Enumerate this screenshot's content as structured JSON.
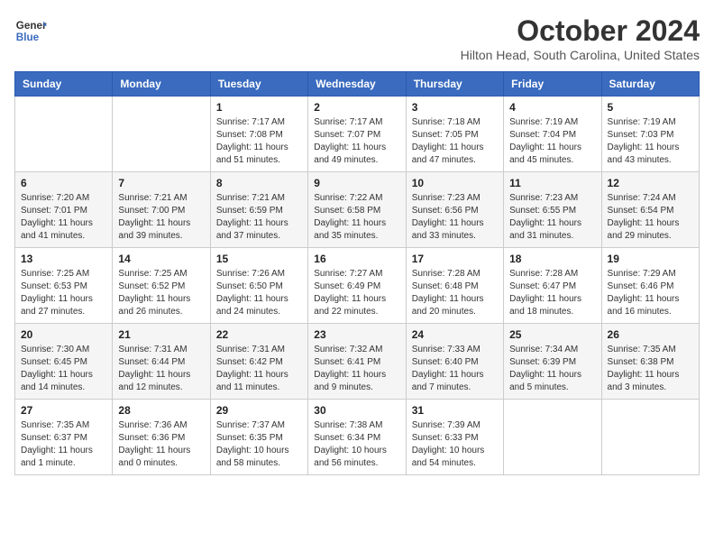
{
  "header": {
    "logo_line1": "General",
    "logo_line2": "Blue",
    "month": "October 2024",
    "location": "Hilton Head, South Carolina, United States"
  },
  "weekdays": [
    "Sunday",
    "Monday",
    "Tuesday",
    "Wednesday",
    "Thursday",
    "Friday",
    "Saturday"
  ],
  "weeks": [
    [
      {
        "day": "",
        "sunrise": "",
        "sunset": "",
        "daylight": ""
      },
      {
        "day": "",
        "sunrise": "",
        "sunset": "",
        "daylight": ""
      },
      {
        "day": "1",
        "sunrise": "Sunrise: 7:17 AM",
        "sunset": "Sunset: 7:08 PM",
        "daylight": "Daylight: 11 hours and 51 minutes."
      },
      {
        "day": "2",
        "sunrise": "Sunrise: 7:17 AM",
        "sunset": "Sunset: 7:07 PM",
        "daylight": "Daylight: 11 hours and 49 minutes."
      },
      {
        "day": "3",
        "sunrise": "Sunrise: 7:18 AM",
        "sunset": "Sunset: 7:05 PM",
        "daylight": "Daylight: 11 hours and 47 minutes."
      },
      {
        "day": "4",
        "sunrise": "Sunrise: 7:19 AM",
        "sunset": "Sunset: 7:04 PM",
        "daylight": "Daylight: 11 hours and 45 minutes."
      },
      {
        "day": "5",
        "sunrise": "Sunrise: 7:19 AM",
        "sunset": "Sunset: 7:03 PM",
        "daylight": "Daylight: 11 hours and 43 minutes."
      }
    ],
    [
      {
        "day": "6",
        "sunrise": "Sunrise: 7:20 AM",
        "sunset": "Sunset: 7:01 PM",
        "daylight": "Daylight: 11 hours and 41 minutes."
      },
      {
        "day": "7",
        "sunrise": "Sunrise: 7:21 AM",
        "sunset": "Sunset: 7:00 PM",
        "daylight": "Daylight: 11 hours and 39 minutes."
      },
      {
        "day": "8",
        "sunrise": "Sunrise: 7:21 AM",
        "sunset": "Sunset: 6:59 PM",
        "daylight": "Daylight: 11 hours and 37 minutes."
      },
      {
        "day": "9",
        "sunrise": "Sunrise: 7:22 AM",
        "sunset": "Sunset: 6:58 PM",
        "daylight": "Daylight: 11 hours and 35 minutes."
      },
      {
        "day": "10",
        "sunrise": "Sunrise: 7:23 AM",
        "sunset": "Sunset: 6:56 PM",
        "daylight": "Daylight: 11 hours and 33 minutes."
      },
      {
        "day": "11",
        "sunrise": "Sunrise: 7:23 AM",
        "sunset": "Sunset: 6:55 PM",
        "daylight": "Daylight: 11 hours and 31 minutes."
      },
      {
        "day": "12",
        "sunrise": "Sunrise: 7:24 AM",
        "sunset": "Sunset: 6:54 PM",
        "daylight": "Daylight: 11 hours and 29 minutes."
      }
    ],
    [
      {
        "day": "13",
        "sunrise": "Sunrise: 7:25 AM",
        "sunset": "Sunset: 6:53 PM",
        "daylight": "Daylight: 11 hours and 27 minutes."
      },
      {
        "day": "14",
        "sunrise": "Sunrise: 7:25 AM",
        "sunset": "Sunset: 6:52 PM",
        "daylight": "Daylight: 11 hours and 26 minutes."
      },
      {
        "day": "15",
        "sunrise": "Sunrise: 7:26 AM",
        "sunset": "Sunset: 6:50 PM",
        "daylight": "Daylight: 11 hours and 24 minutes."
      },
      {
        "day": "16",
        "sunrise": "Sunrise: 7:27 AM",
        "sunset": "Sunset: 6:49 PM",
        "daylight": "Daylight: 11 hours and 22 minutes."
      },
      {
        "day": "17",
        "sunrise": "Sunrise: 7:28 AM",
        "sunset": "Sunset: 6:48 PM",
        "daylight": "Daylight: 11 hours and 20 minutes."
      },
      {
        "day": "18",
        "sunrise": "Sunrise: 7:28 AM",
        "sunset": "Sunset: 6:47 PM",
        "daylight": "Daylight: 11 hours and 18 minutes."
      },
      {
        "day": "19",
        "sunrise": "Sunrise: 7:29 AM",
        "sunset": "Sunset: 6:46 PM",
        "daylight": "Daylight: 11 hours and 16 minutes."
      }
    ],
    [
      {
        "day": "20",
        "sunrise": "Sunrise: 7:30 AM",
        "sunset": "Sunset: 6:45 PM",
        "daylight": "Daylight: 11 hours and 14 minutes."
      },
      {
        "day": "21",
        "sunrise": "Sunrise: 7:31 AM",
        "sunset": "Sunset: 6:44 PM",
        "daylight": "Daylight: 11 hours and 12 minutes."
      },
      {
        "day": "22",
        "sunrise": "Sunrise: 7:31 AM",
        "sunset": "Sunset: 6:42 PM",
        "daylight": "Daylight: 11 hours and 11 minutes."
      },
      {
        "day": "23",
        "sunrise": "Sunrise: 7:32 AM",
        "sunset": "Sunset: 6:41 PM",
        "daylight": "Daylight: 11 hours and 9 minutes."
      },
      {
        "day": "24",
        "sunrise": "Sunrise: 7:33 AM",
        "sunset": "Sunset: 6:40 PM",
        "daylight": "Daylight: 11 hours and 7 minutes."
      },
      {
        "day": "25",
        "sunrise": "Sunrise: 7:34 AM",
        "sunset": "Sunset: 6:39 PM",
        "daylight": "Daylight: 11 hours and 5 minutes."
      },
      {
        "day": "26",
        "sunrise": "Sunrise: 7:35 AM",
        "sunset": "Sunset: 6:38 PM",
        "daylight": "Daylight: 11 hours and 3 minutes."
      }
    ],
    [
      {
        "day": "27",
        "sunrise": "Sunrise: 7:35 AM",
        "sunset": "Sunset: 6:37 PM",
        "daylight": "Daylight: 11 hours and 1 minute."
      },
      {
        "day": "28",
        "sunrise": "Sunrise: 7:36 AM",
        "sunset": "Sunset: 6:36 PM",
        "daylight": "Daylight: 11 hours and 0 minutes."
      },
      {
        "day": "29",
        "sunrise": "Sunrise: 7:37 AM",
        "sunset": "Sunset: 6:35 PM",
        "daylight": "Daylight: 10 hours and 58 minutes."
      },
      {
        "day": "30",
        "sunrise": "Sunrise: 7:38 AM",
        "sunset": "Sunset: 6:34 PM",
        "daylight": "Daylight: 10 hours and 56 minutes."
      },
      {
        "day": "31",
        "sunrise": "Sunrise: 7:39 AM",
        "sunset": "Sunset: 6:33 PM",
        "daylight": "Daylight: 10 hours and 54 minutes."
      },
      {
        "day": "",
        "sunrise": "",
        "sunset": "",
        "daylight": ""
      },
      {
        "day": "",
        "sunrise": "",
        "sunset": "",
        "daylight": ""
      }
    ]
  ]
}
